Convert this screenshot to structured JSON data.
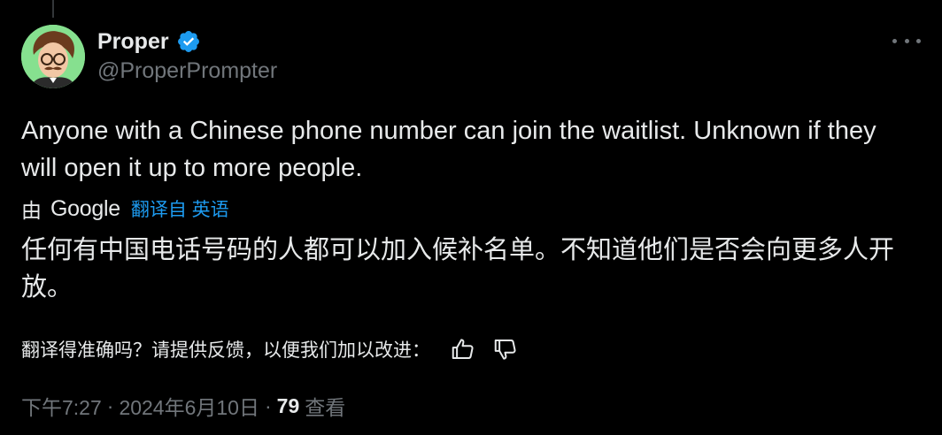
{
  "author": {
    "display_name": "Proper",
    "handle": "@ProperPrompter",
    "verified": true
  },
  "tweet": {
    "text": "Anyone with a Chinese phone number can join the waitlist. Unknown if they will open it up to more people."
  },
  "translation": {
    "by_label": "由",
    "provider": "Google",
    "link_label": "翻译自 英语",
    "text": "任何有中国电话号码的人都可以加入候补名单。不知道他们是否会向更多人开放。",
    "feedback_prompt": "翻译得准确吗？请提供反馈，以便我们加以改进："
  },
  "meta": {
    "time": "下午7:27",
    "separator": "·",
    "date": "2024年6月10日",
    "views_count": "79",
    "views_label": "查看"
  },
  "colors": {
    "background": "#000000",
    "text": "#e7e9ea",
    "muted": "#71767b",
    "link": "#1d9bf0",
    "verified_badge": "#1d9bf0"
  },
  "icons": {
    "verified": "verified-badge-icon",
    "more": "more-icon",
    "thumbs_up": "thumbs-up-icon",
    "thumbs_down": "thumbs-down-icon"
  }
}
